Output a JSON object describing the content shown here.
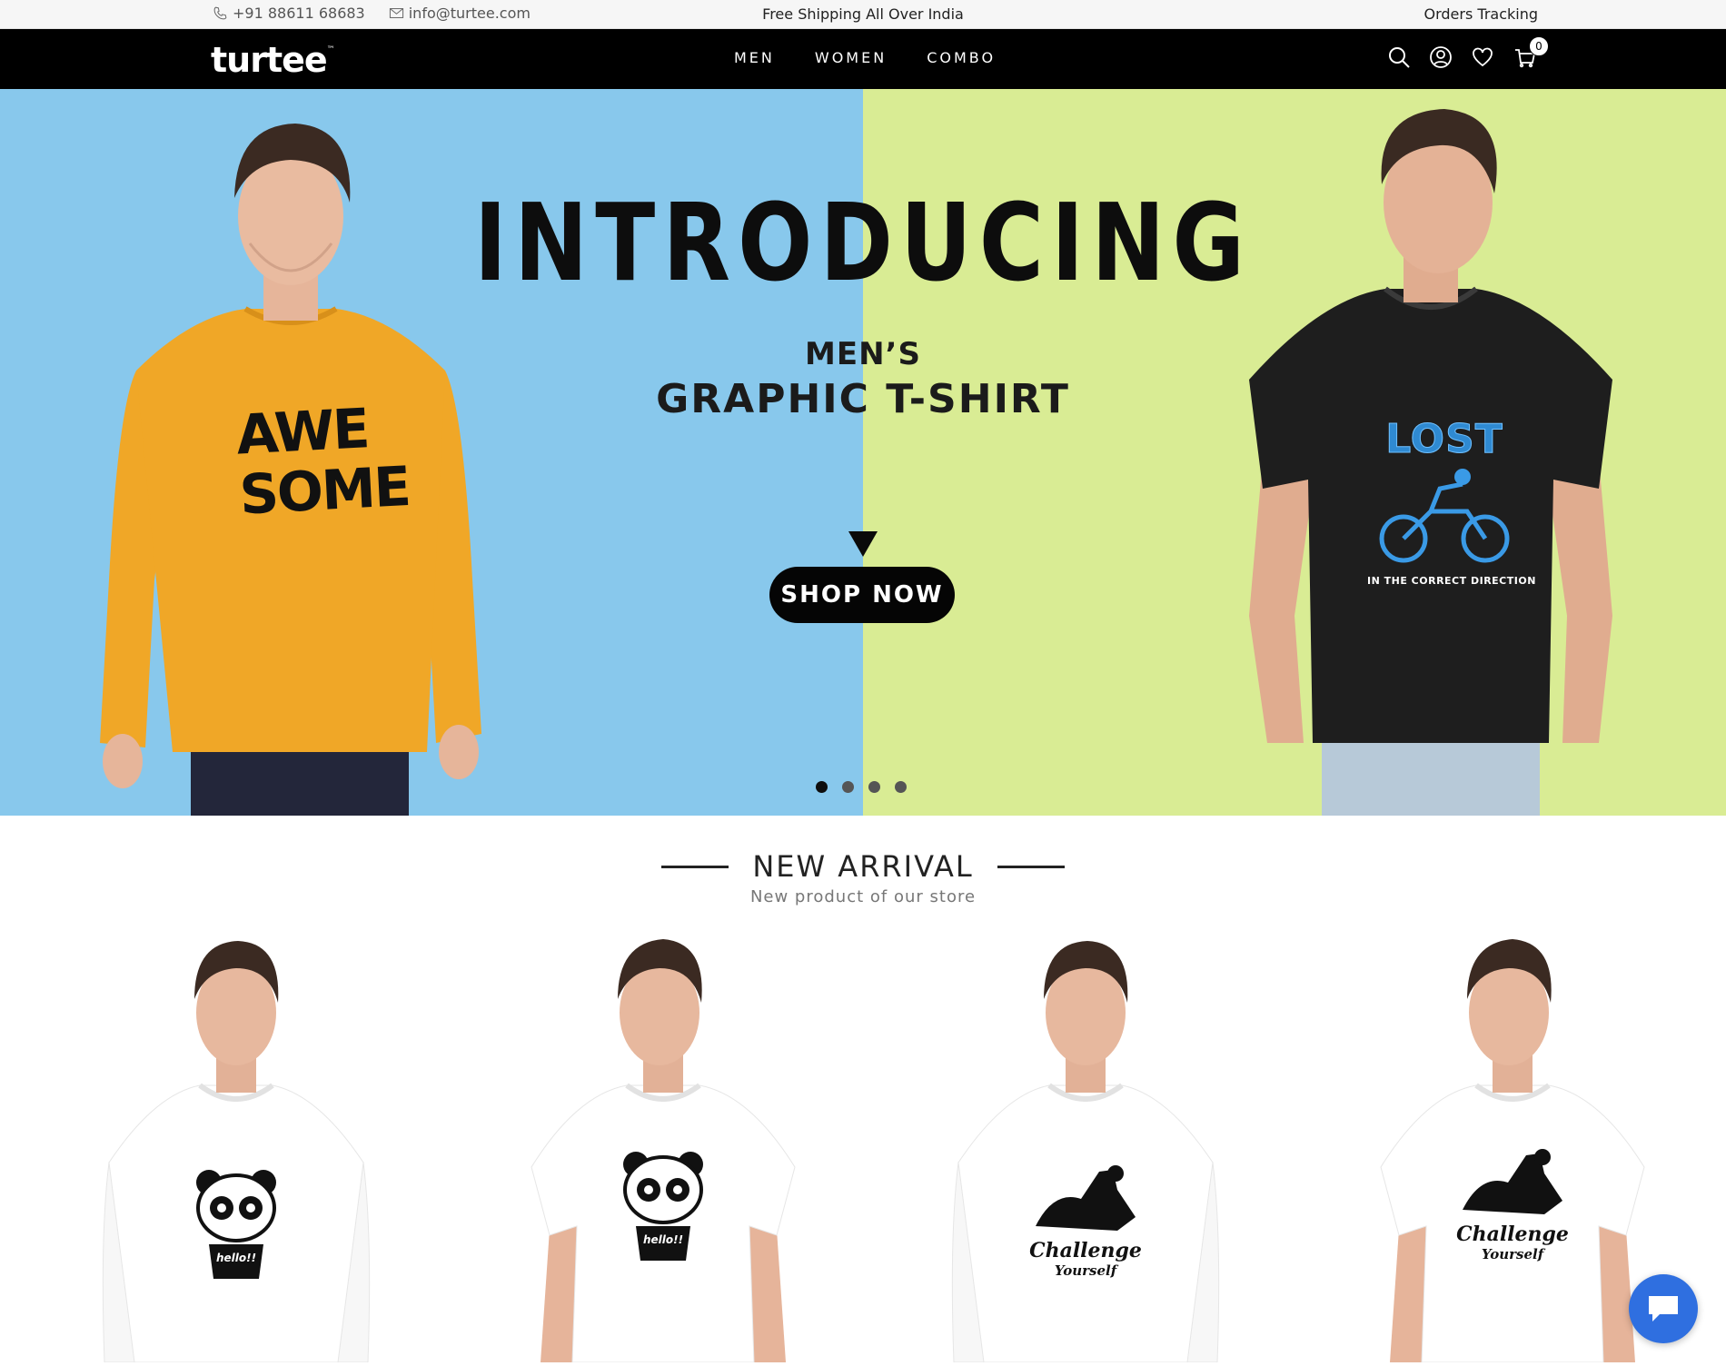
{
  "topbar": {
    "phone": "+91 88611 68683",
    "email": "info@turtee.com",
    "shipping": "Free Shipping All Over India",
    "tracking": "Orders Tracking"
  },
  "nav": {
    "logo": "turtee",
    "logo_tm": "™",
    "menu": [
      "MEN",
      "WOMEN",
      "COMBO"
    ],
    "cart_count": "0"
  },
  "hero": {
    "headline": "INTRODUCING",
    "sub1": "MEN’S",
    "sub2": "GRAPHIC T-SHIRT",
    "cta": "SHOP NOW",
    "left_tee_print": [
      "AWE",
      "SOME"
    ],
    "right_tee_print": "LOST",
    "right_tee_caption": "IN THE CORRECT DIRECTION",
    "slides": 4,
    "active_slide": 0,
    "colors": {
      "left": "#88c8ec",
      "right": "#d9ec94",
      "left_tee": "#f0a727",
      "right_tee": "#1e1e1e"
    }
  },
  "section": {
    "title": "NEW ARRIVAL",
    "subtitle": "New product of our store"
  },
  "products": [
    {
      "print_text": "hello!!"
    },
    {
      "print_text": "hello!!"
    },
    {
      "print_text": "Challenge",
      "print_text2": "Yourself"
    },
    {
      "print_text": "Challenge",
      "print_text2": "Yourself"
    }
  ]
}
